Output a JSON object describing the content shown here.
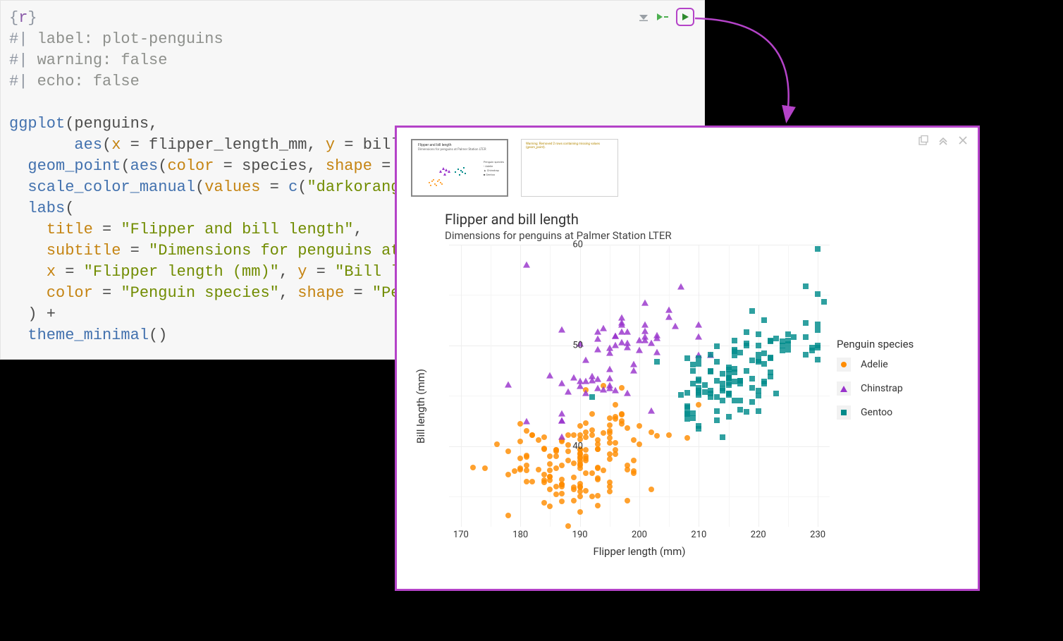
{
  "code": {
    "chunk_header": {
      "open": "{",
      "lang": "r",
      "close": "}"
    },
    "options": [
      {
        "prefix": "#|",
        "key": "label:",
        "value": "plot-penguins"
      },
      {
        "prefix": "#|",
        "key": "warning:",
        "value": "false"
      },
      {
        "prefix": "#|",
        "key": "echo:",
        "value": "false"
      }
    ],
    "lines": [
      {
        "segments": [
          {
            "t": "ggplot",
            "c": "tok-func"
          },
          {
            "t": "(penguins,",
            "c": "tok-op"
          }
        ]
      },
      {
        "segments": [
          {
            "t": "       ",
            "c": ""
          },
          {
            "t": "aes",
            "c": "tok-func"
          },
          {
            "t": "(",
            "c": "tok-op"
          },
          {
            "t": "x",
            "c": "tok-arg"
          },
          {
            "t": " = flipper_length_mm, ",
            "c": "tok-op"
          },
          {
            "t": "y",
            "c": "tok-arg"
          },
          {
            "t": " = bill_l",
            "c": "tok-op"
          }
        ]
      },
      {
        "segments": [
          {
            "t": "  ",
            "c": ""
          },
          {
            "t": "geom_point",
            "c": "tok-func"
          },
          {
            "t": "(",
            "c": "tok-op"
          },
          {
            "t": "aes",
            "c": "tok-func"
          },
          {
            "t": "(",
            "c": "tok-op"
          },
          {
            "t": "color",
            "c": "tok-arg"
          },
          {
            "t": " = species, ",
            "c": "tok-op"
          },
          {
            "t": "shape",
            "c": "tok-arg"
          },
          {
            "t": " = sp",
            "c": "tok-op"
          }
        ]
      },
      {
        "segments": [
          {
            "t": "  ",
            "c": ""
          },
          {
            "t": "scale_color_manual",
            "c": "tok-func"
          },
          {
            "t": "(",
            "c": "tok-op"
          },
          {
            "t": "values",
            "c": "tok-arg"
          },
          {
            "t": " = ",
            "c": "tok-op"
          },
          {
            "t": "c",
            "c": "tok-func"
          },
          {
            "t": "(",
            "c": "tok-op"
          },
          {
            "t": "\"darkorange\"",
            "c": "tok-str"
          }
        ]
      },
      {
        "segments": [
          {
            "t": "  ",
            "c": ""
          },
          {
            "t": "labs",
            "c": "tok-func"
          },
          {
            "t": "(",
            "c": "tok-op"
          }
        ]
      },
      {
        "segments": [
          {
            "t": "    ",
            "c": ""
          },
          {
            "t": "title",
            "c": "tok-arg"
          },
          {
            "t": " = ",
            "c": "tok-op"
          },
          {
            "t": "\"Flipper and bill length\"",
            "c": "tok-str"
          },
          {
            "t": ",",
            "c": "tok-op"
          }
        ]
      },
      {
        "segments": [
          {
            "t": "    ",
            "c": ""
          },
          {
            "t": "subtitle",
            "c": "tok-arg"
          },
          {
            "t": " = ",
            "c": "tok-op"
          },
          {
            "t": "\"Dimensions for penguins at P",
            "c": "tok-str"
          }
        ]
      },
      {
        "segments": [
          {
            "t": "    ",
            "c": ""
          },
          {
            "t": "x",
            "c": "tok-arg"
          },
          {
            "t": " = ",
            "c": "tok-op"
          },
          {
            "t": "\"Flipper length (mm)\"",
            "c": "tok-str"
          },
          {
            "t": ", ",
            "c": "tok-op"
          },
          {
            "t": "y",
            "c": "tok-arg"
          },
          {
            "t": " = ",
            "c": "tok-op"
          },
          {
            "t": "\"Bill len",
            "c": "tok-str"
          }
        ]
      },
      {
        "segments": [
          {
            "t": "    ",
            "c": ""
          },
          {
            "t": "color",
            "c": "tok-arg"
          },
          {
            "t": " = ",
            "c": "tok-op"
          },
          {
            "t": "\"Penguin species\"",
            "c": "tok-str"
          },
          {
            "t": ", ",
            "c": "tok-op"
          },
          {
            "t": "shape",
            "c": "tok-arg"
          },
          {
            "t": " = ",
            "c": "tok-op"
          },
          {
            "t": "\"Peng",
            "c": "tok-str"
          }
        ]
      },
      {
        "segments": [
          {
            "t": "  ) +",
            "c": "tok-op"
          }
        ]
      },
      {
        "segments": [
          {
            "t": "  ",
            "c": ""
          },
          {
            "t": "theme_minimal",
            "c": "tok-func"
          },
          {
            "t": "()",
            "c": "tok-op"
          }
        ]
      }
    ]
  },
  "output_thumbs": {
    "plot_title": "Flipper and bill length",
    "plot_subtitle": "Dimensions for penguins at Palmer Station LTER",
    "warning_text": "Warning: Removed 2 rows containing missing values (geom_point)."
  },
  "chart_data": {
    "type": "scatter",
    "title": "Flipper and bill length",
    "subtitle": "Dimensions for penguins at Palmer Station LTER",
    "xlabel": "Flipper length (mm)",
    "ylabel": "Bill length (mm)",
    "legend_title": "Penguin species",
    "xlim": [
      168,
      232
    ],
    "ylim": [
      32,
      60
    ],
    "x_ticks": [
      170,
      180,
      190,
      200,
      210,
      220,
      230
    ],
    "y_ticks": [
      40,
      50,
      60
    ],
    "colors": {
      "Adelie": "#ff8c00",
      "Chinstrap": "#9933cc",
      "Gentoo": "#008b8b"
    },
    "shapes": {
      "Adelie": "circle",
      "Chinstrap": "triangle",
      "Gentoo": "square"
    },
    "series": [
      {
        "name": "Adelie",
        "x": [
          181,
          186,
          195,
          193,
          190,
          181,
          195,
          193,
          190,
          186,
          180,
          182,
          191,
          198,
          185,
          195,
          197,
          184,
          194,
          174,
          180,
          189,
          185,
          180,
          187,
          183,
          187,
          172,
          180,
          178,
          178,
          188,
          184,
          195,
          196,
          190,
          180,
          181,
          184,
          182,
          195,
          186,
          196,
          185,
          190,
          182,
          179,
          190,
          191,
          186,
          188,
          190,
          200,
          187,
          191,
          186,
          193,
          181,
          194,
          185,
          195,
          185,
          192,
          184,
          192,
          195,
          188,
          190,
          198,
          190,
          190,
          196,
          197,
          190,
          195,
          191,
          184,
          187,
          195,
          189,
          196,
          187,
          193,
          191,
          194,
          190,
          189,
          189,
          190,
          202,
          205,
          185,
          186,
          187,
          208,
          190,
          196,
          178,
          192,
          192,
          203,
          183,
          190,
          193,
          184,
          199,
          190,
          181,
          197,
          198,
          191,
          193,
          197,
          191,
          196,
          188,
          199,
          189,
          189,
          187,
          198,
          176,
          202,
          186,
          199,
          191,
          195,
          191,
          210,
          190,
          197,
          193,
          199,
          187,
          190,
          191,
          200,
          185,
          193,
          193,
          187,
          188,
          190,
          192,
          185,
          190,
          184,
          195,
          193,
          187,
          181
        ],
        "y": [
          39.1,
          39.5,
          40.3,
          36.7,
          39.3,
          38.9,
          39.2,
          34.1,
          42.0,
          37.8,
          37.8,
          41.1,
          38.6,
          34.6,
          36.6,
          38.7,
          42.5,
          34.4,
          46.0,
          37.8,
          37.7,
          35.9,
          38.2,
          38.8,
          35.3,
          40.6,
          40.5,
          37.9,
          40.5,
          39.5,
          37.2,
          39.5,
          40.9,
          36.4,
          39.2,
          38.8,
          42.2,
          37.6,
          39.8,
          36.5,
          40.8,
          36.0,
          44.1,
          37.0,
          39.6,
          41.1,
          37.5,
          36.0,
          42.3,
          39.6,
          40.1,
          35.0,
          42.0,
          34.5,
          41.4,
          39.0,
          40.6,
          36.5,
          37.6,
          35.7,
          41.3,
          37.6,
          41.1,
          36.4,
          41.6,
          35.5,
          41.1,
          35.9,
          41.8,
          33.5,
          39.7,
          39.6,
          45.8,
          35.5,
          42.8,
          40.9,
          37.2,
          36.2,
          42.1,
          34.6,
          42.9,
          36.7,
          35.1,
          37.3,
          41.3,
          36.3,
          36.9,
          38.3,
          38.9,
          35.7,
          41.1,
          34.0,
          39.6,
          36.2,
          40.8,
          38.1,
          40.3,
          33.1,
          43.2,
          35.0,
          41.0,
          37.7,
          37.8,
          37.9,
          39.7,
          38.6,
          38.2,
          38.1,
          43.2,
          38.1,
          45.6,
          39.7,
          42.2,
          39.6,
          42.7,
          38.6,
          37.3,
          35.7,
          41.1,
          36.2,
          37.7,
          40.2,
          41.4,
          35.2,
          40.6,
          38.8,
          41.5,
          39.0,
          44.1,
          38.5,
          43.1,
          36.8,
          37.5,
          38.1,
          41.1,
          35.6,
          40.2,
          37.0,
          39.7,
          40.2,
          40.6,
          32.1,
          40.7,
          37.3,
          39.0,
          39.2,
          36.6,
          36.0,
          37.8,
          36.0,
          41.5
        ]
      },
      {
        "name": "Chinstrap",
        "x": [
          192,
          196,
          193,
          188,
          197,
          198,
          178,
          197,
          195,
          198,
          193,
          194,
          185,
          201,
          190,
          201,
          197,
          181,
          190,
          195,
          181,
          191,
          187,
          193,
          195,
          197,
          200,
          200,
          191,
          205,
          187,
          201,
          187,
          203,
          195,
          199,
          195,
          210,
          192,
          205,
          210,
          187,
          196,
          196,
          196,
          201,
          190,
          212,
          187,
          198,
          199,
          201,
          193,
          203,
          187,
          197,
          191,
          203,
          202,
          194,
          206,
          189,
          195,
          207,
          202,
          193,
          210,
          198
        ],
        "y": [
          46.5,
          50.0,
          51.3,
          45.4,
          52.7,
          45.2,
          46.1,
          51.3,
          46.0,
          51.3,
          46.6,
          51.7,
          47.0,
          52.0,
          45.9,
          50.5,
          50.3,
          58.0,
          46.4,
          49.2,
          42.4,
          48.5,
          43.2,
          50.6,
          46.7,
          52.0,
          50.5,
          49.5,
          46.4,
          52.8,
          40.9,
          54.2,
          42.5,
          51.0,
          49.7,
          47.5,
          47.6,
          52.0,
          46.9,
          53.5,
          49.0,
          46.2,
          50.9,
          45.5,
          50.9,
          50.8,
          50.1,
          49.0,
          51.5,
          49.8,
          48.1,
          51.4,
          45.7,
          50.7,
          42.5,
          52.2,
          45.2,
          49.3,
          50.2,
          45.6,
          51.9,
          46.8,
          45.7,
          55.8,
          43.5,
          49.6,
          50.8,
          50.2
        ]
      },
      {
        "name": "Gentoo",
        "x": [
          211,
          230,
          210,
          218,
          215,
          210,
          211,
          219,
          209,
          215,
          214,
          216,
          214,
          213,
          210,
          217,
          210,
          221,
          209,
          222,
          218,
          215,
          213,
          215,
          215,
          215,
          216,
          215,
          210,
          220,
          222,
          209,
          207,
          230,
          220,
          220,
          213,
          219,
          208,
          208,
          208,
          225,
          210,
          216,
          222,
          217,
          210,
          225,
          213,
          215,
          210,
          220,
          210,
          225,
          217,
          220,
          208,
          220,
          208,
          224,
          208,
          221,
          214,
          231,
          219,
          230,
          214,
          229,
          220,
          223,
          216,
          221,
          221,
          217,
          216,
          230,
          209,
          220,
          215,
          223,
          212,
          221,
          212,
          224,
          212,
          228,
          218,
          218,
          212,
          230,
          218,
          228,
          212,
          224,
          214,
          226,
          216,
          222,
          203,
          225,
          219,
          228,
          215,
          228,
          216,
          215,
          210,
          219,
          208,
          209,
          216,
          229,
          213,
          230,
          217,
          230,
          217,
          222,
          214,
          215,
          222,
          212,
          213,
          192
        ],
        "y": [
          46.1,
          50.0,
          48.7,
          50.0,
          47.6,
          46.5,
          45.4,
          46.7,
          43.3,
          46.8,
          40.9,
          49.0,
          45.5,
          48.4,
          45.8,
          49.3,
          42.0,
          49.2,
          46.2,
          48.7,
          50.2,
          45.1,
          46.5,
          46.3,
          42.9,
          46.1,
          44.5,
          47.8,
          48.2,
          50.0,
          47.3,
          42.8,
          45.1,
          59.6,
          49.1,
          48.4,
          42.6,
          44.4,
          44.0,
          48.7,
          42.7,
          49.6,
          45.3,
          49.6,
          50.5,
          43.6,
          45.5,
          50.5,
          44.9,
          45.2,
          46.6,
          48.5,
          45.1,
          50.1,
          46.5,
          45.0,
          43.8,
          45.5,
          43.2,
          50.4,
          45.3,
          46.2,
          45.7,
          54.3,
          45.8,
          49.8,
          46.2,
          49.5,
          43.5,
          50.7,
          47.7,
          46.4,
          48.2,
          46.5,
          46.4,
          48.6,
          47.5,
          51.1,
          45.2,
          45.2,
          49.1,
          52.5,
          47.4,
          50.0,
          44.9,
          50.8,
          43.4,
          51.3,
          47.5,
          52.1,
          47.5,
          52.2,
          45.5,
          49.5,
          44.5,
          50.8,
          49.4,
          46.9,
          48.4,
          51.1,
          48.5,
          55.9,
          47.2,
          49.1,
          47.3,
          46.8,
          41.7,
          53.4,
          43.3,
          48.1,
          50.5,
          49.8,
          43.5,
          51.5,
          46.2,
          55.1,
          44.5,
          48.8,
          47.2,
          46.8,
          50.4,
          45.2,
          49.9,
          44.9
        ]
      }
    ]
  }
}
